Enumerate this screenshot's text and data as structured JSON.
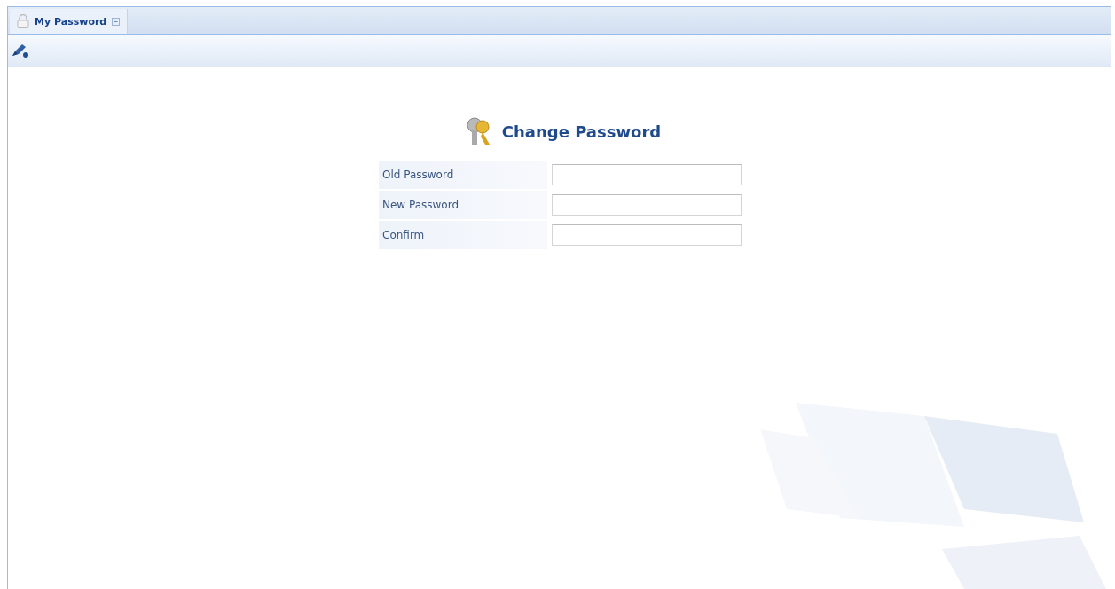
{
  "tabs": [
    {
      "label": "My Password",
      "selected": true
    }
  ],
  "form": {
    "title": "Change Password",
    "fields": [
      {
        "label": "Old Password"
      },
      {
        "label": "New Password"
      },
      {
        "label": "Confirm"
      }
    ]
  }
}
